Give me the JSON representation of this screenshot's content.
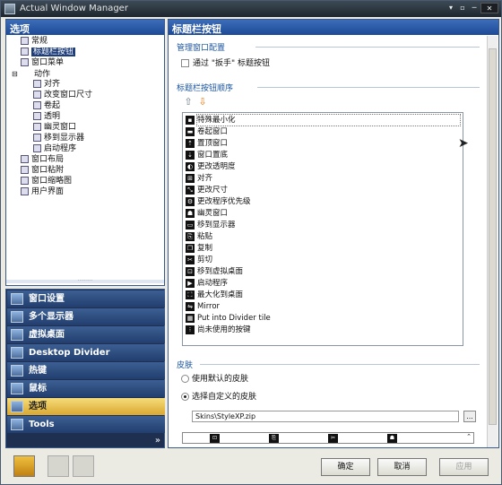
{
  "app": {
    "title": "Actual Window Manager"
  },
  "window_controls": [
    "▾",
    "▫",
    "─",
    "✕"
  ],
  "left_panel": {
    "header": "选项",
    "tree": [
      {
        "label": "常规",
        "depth": 1
      },
      {
        "label": "标题栏按钮",
        "depth": 1,
        "selected": true
      },
      {
        "label": "窗口菜单",
        "depth": 1
      },
      {
        "label": "动作",
        "depth": 1
      },
      {
        "label": "对齐",
        "depth": 2
      },
      {
        "label": "改变窗口尺寸",
        "depth": 2
      },
      {
        "label": "卷起",
        "depth": 2
      },
      {
        "label": "透明",
        "depth": 2
      },
      {
        "label": "幽灵窗口",
        "depth": 2
      },
      {
        "label": "移到显示器",
        "depth": 2
      },
      {
        "label": "启动程序",
        "depth": 2
      },
      {
        "label": "窗口布局",
        "depth": 1
      },
      {
        "label": "窗口粘附",
        "depth": 1
      },
      {
        "label": "窗口缩略图",
        "depth": 1
      },
      {
        "label": "用户界面",
        "depth": 1
      }
    ],
    "nav": [
      {
        "label": "窗口设置"
      },
      {
        "label": "多个显示器"
      },
      {
        "label": "虚拟桌面"
      },
      {
        "label": "Desktop Divider"
      },
      {
        "label": "热键"
      },
      {
        "label": "鼠标"
      },
      {
        "label": "选项",
        "selected": true
      },
      {
        "label": "Tools"
      }
    ],
    "more": "»"
  },
  "main": {
    "header": "标题栏按钮",
    "manage_section": {
      "title": "管理窗口配置",
      "checkbox_label": "通过 \"扳手\" 标题按钮"
    },
    "order_section": {
      "title": "标题栏按钮顺序",
      "up": "⇧",
      "down": "⇩",
      "items": [
        {
          "label": "特殊最小化",
          "icon": "▪"
        },
        {
          "label": "卷起窗口",
          "icon": "▬"
        },
        {
          "label": "置顶窗口",
          "icon": "⇡"
        },
        {
          "label": "窗口置底",
          "icon": "⇣"
        },
        {
          "label": "更改透明度",
          "icon": "◐"
        },
        {
          "label": "对齐",
          "icon": "⊞"
        },
        {
          "label": "更改尺寸",
          "icon": "⤡"
        },
        {
          "label": "更改程序优先级",
          "icon": "⚙"
        },
        {
          "label": "幽灵窗口",
          "icon": "☗"
        },
        {
          "label": "移到显示器",
          "icon": "▭"
        },
        {
          "label": "粘贴",
          "icon": "⎘"
        },
        {
          "label": "复制",
          "icon": "❐"
        },
        {
          "label": "剪切",
          "icon": "✂"
        },
        {
          "label": "移到虚拟桌面",
          "icon": "⊡"
        },
        {
          "label": "启动程序",
          "icon": "▶"
        },
        {
          "label": "最大化到桌面",
          "icon": "⛶"
        },
        {
          "label": "Mirror",
          "icon": "⇋"
        },
        {
          "label": "Put into Divider tile",
          "icon": "▦"
        },
        {
          "label": "尚未使用的按键",
          "icon": "⁝"
        }
      ]
    },
    "skin_section": {
      "title": "皮肤",
      "option_default": "使用默认的皮肤",
      "option_custom": "选择自定义的皮肤",
      "selected": "custom",
      "path": "Skins\\StyleXP.zip",
      "browse": "...",
      "preview_icons": [
        "⊡",
        "⎘",
        "✂",
        "☗"
      ]
    }
  },
  "footer": {
    "ok": "确定",
    "cancel": "取消",
    "apply": "应用"
  }
}
